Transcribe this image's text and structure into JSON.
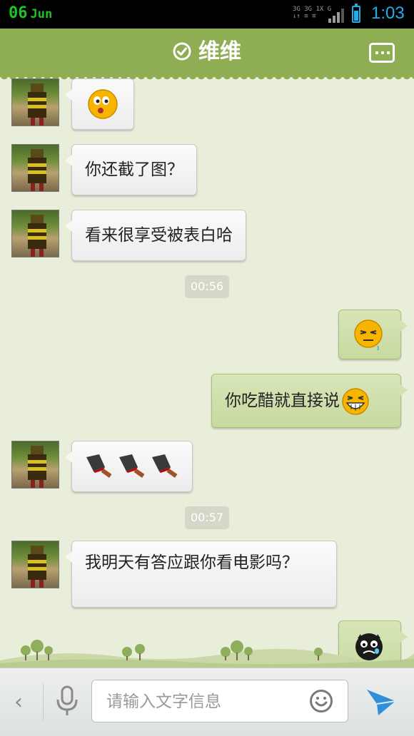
{
  "status_bar": {
    "date_day": "06",
    "date_month": "Jun",
    "network_line1": "3G 3G 1X  G",
    "network_line2": "↓↑ ≡  ≡",
    "time": "1:03"
  },
  "header": {
    "title": "维维",
    "title_icon": "check-circle-icon",
    "menu_icon": "more-dots-icon"
  },
  "messages": [
    {
      "side": "in",
      "text": "",
      "emoji": "surprised-face-emoji"
    },
    {
      "side": "in",
      "text": "你还截了图？"
    },
    {
      "side": "in",
      "text": "看来很享受被表白哈"
    },
    {
      "type": "timestamp",
      "text": "00:56"
    },
    {
      "side": "out",
      "text": "",
      "emoji": "squint-face-emoji"
    },
    {
      "side": "out",
      "text": "你吃醋就直接说",
      "emoji": "grin-face-emoji"
    },
    {
      "side": "in",
      "text": "",
      "emoji": "cleaver-knife-emoji x3"
    },
    {
      "type": "timestamp",
      "text": "00:57"
    },
    {
      "side": "in",
      "text": "我明天有答应跟你看电影吗？"
    },
    {
      "side": "out",
      "text": "",
      "emoji": "black-crying-face-emoji"
    }
  ],
  "input_bar": {
    "back_label": "‹",
    "placeholder": "请输入文字信息",
    "icons": [
      "microphone-icon",
      "smiley-icon",
      "send-icon"
    ]
  },
  "colors": {
    "header_green": "#8fad53",
    "chat_background": "#e9eedb",
    "outgoing_bubble": "#d0e0ae",
    "incoming_bubble": "#f4f4f4",
    "status_blue": "#21aee8",
    "date_green": "#21c321"
  }
}
